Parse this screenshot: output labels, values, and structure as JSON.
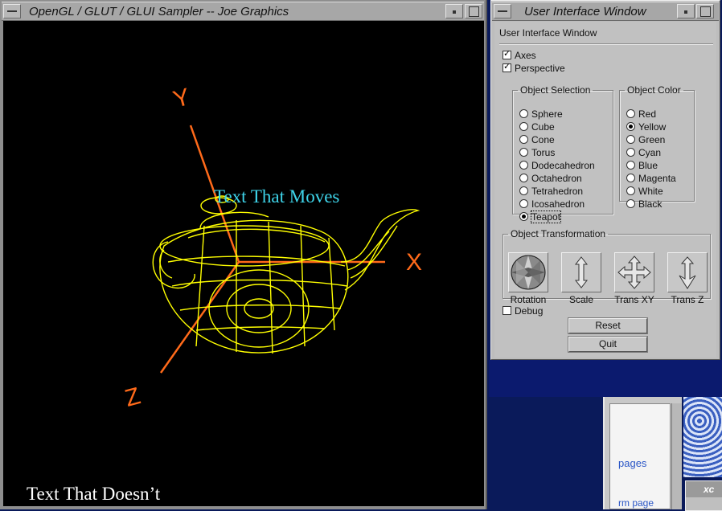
{
  "gl_window": {
    "title": "OpenGL / GLUT / GLUI Sampler -- Joe Graphics",
    "text_moves": "Text That Moves",
    "text_static": "Text That Doesn’t",
    "axis_x": "X",
    "axis_y": "Y",
    "axis_z": "Z",
    "colors": {
      "background": "#000000",
      "axes": "#ff6a1a",
      "object": "#ffff00",
      "moving_text": "#3ed4ea"
    }
  },
  "ui_window": {
    "title": "User Interface Window",
    "header": "User Interface Window",
    "axes_label": "Axes",
    "axes_checked": true,
    "perspective_label": "Perspective",
    "perspective_checked": true,
    "object_selection": {
      "legend": "Object Selection",
      "options": [
        "Sphere",
        "Cube",
        "Cone",
        "Torus",
        "Dodecahedron",
        "Octahedron",
        "Tetrahedron",
        "Icosahedron",
        "Teapot"
      ],
      "selected": "Teapot"
    },
    "object_color": {
      "legend": "Object Color",
      "options": [
        "Red",
        "Yellow",
        "Green",
        "Cyan",
        "Blue",
        "Magenta",
        "White",
        "Black"
      ],
      "selected": "Yellow"
    },
    "object_transformation": {
      "legend": "Object Transformation",
      "tools": [
        "Rotation",
        "Scale",
        "Trans XY",
        "Trans Z"
      ]
    },
    "debug_label": "Debug",
    "debug_checked": false,
    "reset_label": "Reset",
    "quit_label": "Quit"
  },
  "background": {
    "link_pages": "pages",
    "link_form": "rm page",
    "mini_window_title": "xc"
  }
}
